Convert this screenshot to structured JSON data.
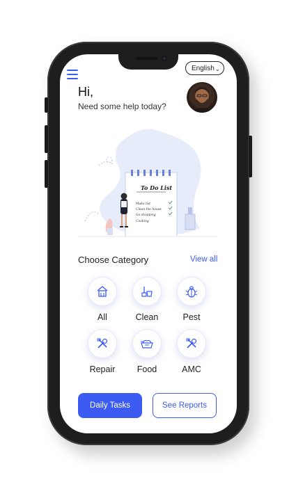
{
  "header": {
    "language": "English",
    "greeting": "Hi,",
    "subtitle": "Need some help today?"
  },
  "illustration": {
    "title": "To Do List",
    "items": [
      "Make list",
      "Clean the house",
      "Go shopping",
      "Cooking"
    ]
  },
  "categories": {
    "title": "Choose Category",
    "view_all": "View all",
    "items": [
      {
        "label": "All",
        "icon": "home-icon"
      },
      {
        "label": "Clean",
        "icon": "broom-bucket-icon"
      },
      {
        "label": "Pest",
        "icon": "bug-icon"
      },
      {
        "label": "Repair",
        "icon": "tools-icon"
      },
      {
        "label": "Food",
        "icon": "food-icon"
      },
      {
        "label": "AMC",
        "icon": "tools-icon"
      }
    ]
  },
  "actions": {
    "daily_tasks": "Daily Tasks",
    "see_reports": "See Reports"
  },
  "colors": {
    "accent": "#3b5bf3",
    "phone_frame": "#1e1e1e"
  }
}
